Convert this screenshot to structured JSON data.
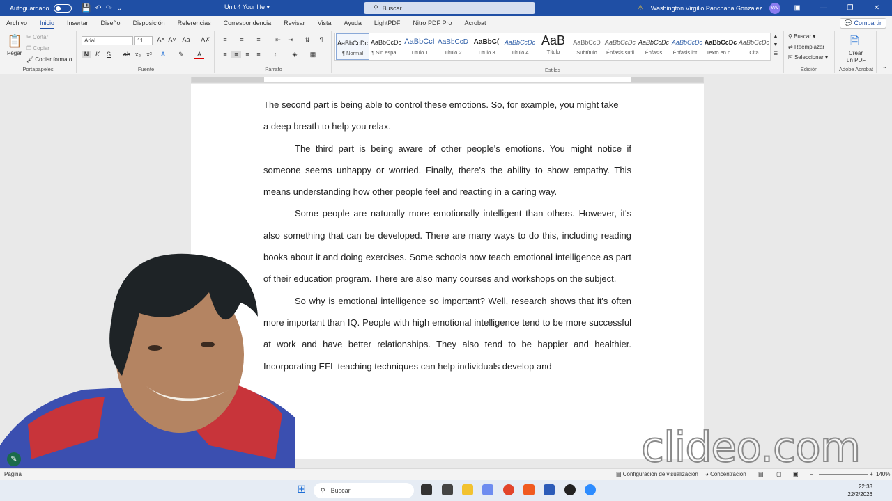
{
  "titlebar": {
    "autosave_label": "Autoguardado",
    "doc_title": "Unit 4 Your life",
    "search_placeholder": "Buscar",
    "user_name": "Washington Virgilio Panchana Gonzalez",
    "user_initials": "WV"
  },
  "menu": {
    "tabs": [
      "Archivo",
      "Inicio",
      "Insertar",
      "Diseño",
      "Disposición",
      "Referencias",
      "Correspondencia",
      "Revisar",
      "Vista",
      "Ayuda",
      "LightPDF",
      "Nitro PDF Pro",
      "Acrobat"
    ],
    "active": "Inicio",
    "share_label": "Compartir"
  },
  "ribbon": {
    "clipboard": {
      "paste": "Pegar",
      "cut": "Cortar",
      "copy": "Copiar",
      "format_painter": "Copiar formato",
      "label": "Portapapeles"
    },
    "font": {
      "family": "Arial",
      "size": "11",
      "label": "Fuente"
    },
    "paragraph": {
      "label": "Párrafo"
    },
    "styles": {
      "label": "Estilos",
      "items": [
        {
          "preview": "AaBbCcDc",
          "name": "¶ Normal"
        },
        {
          "preview": "AaBbCcDc",
          "name": "¶ Sin espa..."
        },
        {
          "preview": "AaBbCcI",
          "name": "Título 1"
        },
        {
          "preview": "AaBbCcD",
          "name": "Título 2"
        },
        {
          "preview": "AaBbC(",
          "name": "Título 3"
        },
        {
          "preview": "AaBbCcDc",
          "name": "Título 4"
        },
        {
          "preview": "AaB",
          "name": "Título"
        },
        {
          "preview": "AaBbCcD",
          "name": "Subtítulo"
        },
        {
          "preview": "AaBbCcDc",
          "name": "Énfasis sutil"
        },
        {
          "preview": "AaBbCcDc",
          "name": "Énfasis"
        },
        {
          "preview": "AaBbCcDc",
          "name": "Énfasis int..."
        },
        {
          "preview": "AaBbCcDc",
          "name": "Texto en n..."
        },
        {
          "preview": "AaBbCcDc",
          "name": "Cita"
        }
      ]
    },
    "editing": {
      "find": "Buscar",
      "replace": "Reemplazar",
      "select": "Seleccionar",
      "label": "Edición"
    },
    "acrobat": {
      "create": "Crear",
      "create2": "un PDF",
      "label": "Adobe Acrobat"
    }
  },
  "document": {
    "p1_line1": "The second part is being able to control these emotions. So, for example, you might take",
    "p1_line2": "a deep breath to help you relax.",
    "p2": "The third part is being aware of other people's emotions. You might notice if someone seems unhappy or worried. Finally, there's the ability to show empathy. This means understanding how other people feel and reacting in a caring way.",
    "p3": "Some people are naturally more emotionally intelligent than others. However, it's also something that can be developed. There are many ways to do this, including reading books about it and doing exercises. Some schools now teach emotional intelligence as part of their education program. There are also many courses and workshops on the subject.",
    "p4": "So why is emotional intelligence so important? Well, research shows that it's often more important than IQ. People with high emotional intelligence tend to be more successful at work and have better relationships. They also tend to be happier and healthier. Incorporating EFL teaching techniques can help individuals develop and"
  },
  "statusbar": {
    "page_label": "Página",
    "display_settings": "Configuración de visualización",
    "focus": "Concentración",
    "zoom": "140%"
  },
  "taskbar": {
    "search": "Buscar",
    "time": "22:33",
    "date": "22/2/2026"
  },
  "watermark": "clideo.com",
  "colors": {
    "accent": "#1f4fa5",
    "page": "#ffffff",
    "workspace": "#e9e9e9"
  }
}
